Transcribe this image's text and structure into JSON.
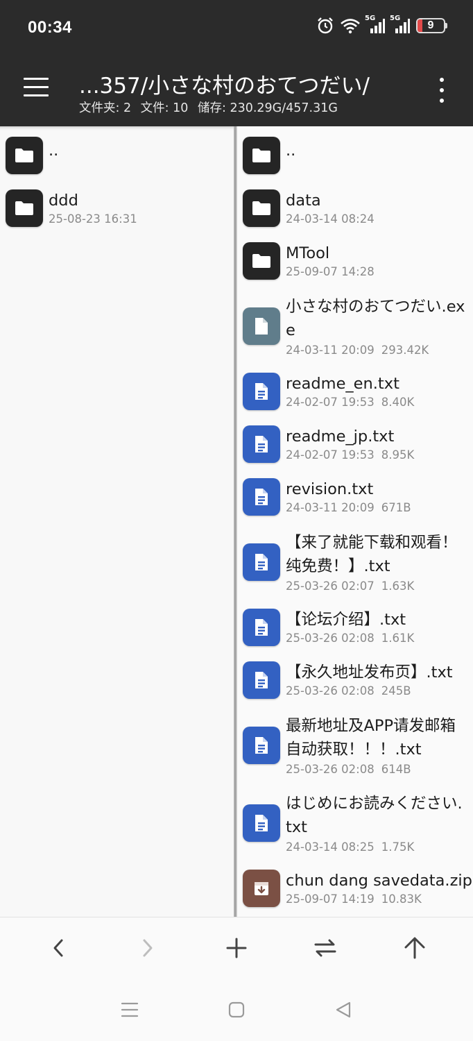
{
  "status_bar": {
    "time": "00:34",
    "icons": [
      "alarm-icon",
      "wifi-icon",
      "signal-5g-icon",
      "signal-5g-icon",
      "battery-icon"
    ],
    "network_1": "5G",
    "network_2": "5G",
    "battery_level": "9",
    "battery_color": "#e24a4a"
  },
  "app_bar": {
    "path": "...357/小さな村のおてつだい/",
    "folders": "文件夹: 2",
    "files": "文件: 10",
    "storage": "储存: 230.29G/457.31G",
    "background": "#2b2b2b"
  },
  "left_pane": {
    "items": [
      {
        "name": "..",
        "meta": "",
        "size": "",
        "icon": "folder-icon"
      },
      {
        "name": "ddd",
        "meta": "25-08-23 16:31",
        "size": "",
        "icon": "folder-icon"
      }
    ]
  },
  "right_pane": {
    "items": [
      {
        "name": "..",
        "date": "",
        "size": "",
        "icon": "folder-icon"
      },
      {
        "name": "data",
        "date": "24-03-14 08:24",
        "size": "",
        "icon": "folder-icon"
      },
      {
        "name": "MTool",
        "date": "25-09-07 14:28",
        "size": "",
        "icon": "folder-icon"
      },
      {
        "name": "小さな村のおてつだい.exe",
        "date": "24-03-11 20:09",
        "size": "293.42K",
        "icon": "file-icon"
      },
      {
        "name": "readme_en.txt",
        "date": "24-02-07 19:53",
        "size": "8.40K",
        "icon": "text-file-icon"
      },
      {
        "name": "readme_jp.txt",
        "date": "24-02-07 19:53",
        "size": "8.95K",
        "icon": "text-file-icon"
      },
      {
        "name": "revision.txt",
        "date": "24-03-11 20:09",
        "size": "671B",
        "icon": "text-file-icon"
      },
      {
        "name": "【来了就能下载和观看！纯免费！】.txt",
        "date": "25-03-26 02:07",
        "size": "1.63K",
        "icon": "text-file-icon"
      },
      {
        "name": "【论坛介绍】.txt",
        "date": "25-03-26 02:08",
        "size": "1.61K",
        "icon": "text-file-icon"
      },
      {
        "name": "【永久地址发布页】.txt",
        "date": "25-03-26 02:08",
        "size": "245B",
        "icon": "text-file-icon"
      },
      {
        "name": "最新地址及APP请发邮箱自动获取！！！.txt",
        "date": "25-03-26 02:08",
        "size": "614B",
        "icon": "text-file-icon"
      },
      {
        "name": "はじめにお読みください.txt",
        "date": "24-03-14 08:25",
        "size": "1.75K",
        "icon": "text-file-icon"
      },
      {
        "name": "chun dang savedata.zip",
        "date": "25-09-07 14:19",
        "size": "10.83K",
        "icon": "archive-icon"
      }
    ]
  },
  "toolbar": {
    "buttons": [
      "back-arrow-icon",
      "forward-arrow-icon",
      "add-icon",
      "swap-panes-icon",
      "up-arrow-icon"
    ],
    "forward_disabled": true
  },
  "nav_bar": {
    "buttons": [
      "recents-icon",
      "home-icon",
      "back-triangle-icon"
    ]
  },
  "colors": {
    "folder": "#252525",
    "text_file": "#3361c2",
    "exe_file": "#607d8b",
    "archive": "#7b5044"
  }
}
